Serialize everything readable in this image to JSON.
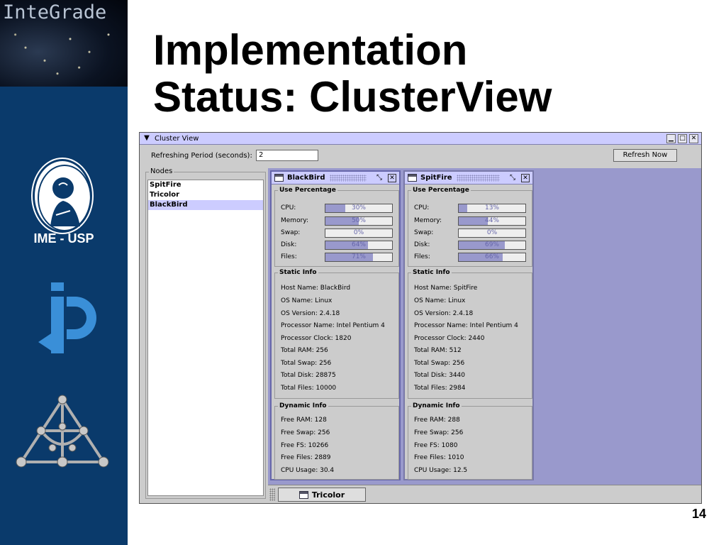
{
  "slide": {
    "title_line1": "Implementation",
    "title_line2": "Status: ClusterView",
    "page_number": "14",
    "logo_text": "InteGrade",
    "ime_label": "IME - USP"
  },
  "window": {
    "title": "Cluster View",
    "refresh_label": "Refreshing Period (seconds):",
    "refresh_value": "2",
    "refresh_button": "Refresh Now"
  },
  "nodes": {
    "legend": "Nodes",
    "items": [
      "SpitFire",
      "Tricolor",
      "BlackBird"
    ],
    "selected": "BlackBird"
  },
  "taskbar": {
    "items": [
      "Tricolor"
    ]
  },
  "frames": [
    {
      "name": "BlackBird",
      "use_title": "Use Percentage",
      "usage": [
        {
          "label": "CPU:",
          "value": 30,
          "text": "30%"
        },
        {
          "label": "Memory:",
          "value": 50,
          "text": "50%"
        },
        {
          "label": "Swap:",
          "value": 0,
          "text": "0%"
        },
        {
          "label": "Disk:",
          "value": 64,
          "text": "64%"
        },
        {
          "label": "Files:",
          "value": 71,
          "text": "71%"
        }
      ],
      "static_title": "Static Info",
      "static": [
        "Host Name: BlackBird",
        "OS Name: Linux",
        "OS Version: 2.4.18",
        "Processor Name: Intel Pentium 4",
        "Processor Clock: 1820",
        "Total RAM: 256",
        "Total Swap: 256",
        "Total Disk: 28875",
        "Total Files: 10000"
      ],
      "dynamic_title": "Dynamic Info",
      "dynamic": [
        "Free RAM: 128",
        "Free Swap: 256",
        "Free FS: 10266",
        "Free Files: 2889",
        "CPU Usage: 30.4"
      ]
    },
    {
      "name": "SpitFire",
      "use_title": "Use Percentage",
      "usage": [
        {
          "label": "CPU:",
          "value": 13,
          "text": "13%"
        },
        {
          "label": "Memory:",
          "value": 44,
          "text": "44%"
        },
        {
          "label": "Swap:",
          "value": 0,
          "text": "0%"
        },
        {
          "label": "Disk:",
          "value": 69,
          "text": "69%"
        },
        {
          "label": "Files:",
          "value": 66,
          "text": "66%"
        }
      ],
      "static_title": "Static Info",
      "static": [
        "Host Name: SpitFire",
        "OS Name: Linux",
        "OS Version: 2.4.18",
        "Processor Name: Intel Pentium 4",
        "Processor Clock: 2440",
        "Total RAM: 512",
        "Total Swap: 256",
        "Total Disk: 3440",
        "Total Files: 2984"
      ],
      "dynamic_title": "Dynamic Info",
      "dynamic": [
        "Free RAM: 288",
        "Free Swap: 256",
        "Free FS: 1080",
        "Free Files: 1010",
        "CPU Usage: 12.5"
      ]
    }
  ]
}
